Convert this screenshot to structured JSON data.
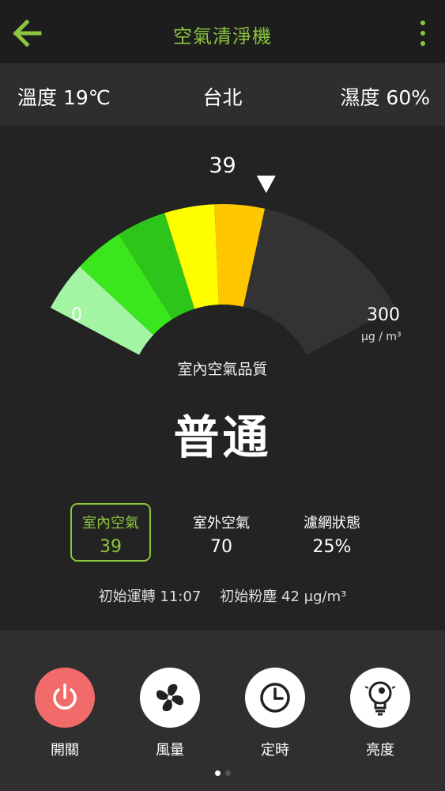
{
  "header": {
    "title": "空氣清淨機",
    "back_icon": "arrow-left-icon",
    "more_icon": "more-vertical-icon",
    "accent_color": "#8cc63f"
  },
  "info": {
    "temperature": "溫度 19℃",
    "city": "台北",
    "humidity": "濕度 60%"
  },
  "gauge": {
    "value": "39",
    "min_label": "0",
    "max_label": "300",
    "unit": "μg / m³",
    "level_fraction": 0.6,
    "segment_colors": [
      "#a3f5a3",
      "#3ae61c",
      "#2ec51a",
      "#ffff00",
      "#ffc700"
    ],
    "empty_color": "#333333"
  },
  "quality": {
    "label": "室內空氣品質",
    "status": "普通"
  },
  "stats": [
    {
      "label": "室內空氣",
      "value": "39",
      "active": true
    },
    {
      "label": "室外空氣",
      "value": "70",
      "active": false
    },
    {
      "label": "濾網狀態",
      "value": "25%",
      "active": false
    }
  ],
  "runtime": {
    "start_time": "初始運轉 11:07",
    "start_dust": "初始粉塵 42 μg/m³"
  },
  "controls": [
    {
      "label": "開關",
      "icon": "power-icon"
    },
    {
      "label": "風量",
      "icon": "fan-icon"
    },
    {
      "label": "定時",
      "icon": "clock-icon"
    },
    {
      "label": "亮度",
      "icon": "lightbulb-icon"
    }
  ],
  "pager": {
    "current": 1,
    "total": 2
  }
}
